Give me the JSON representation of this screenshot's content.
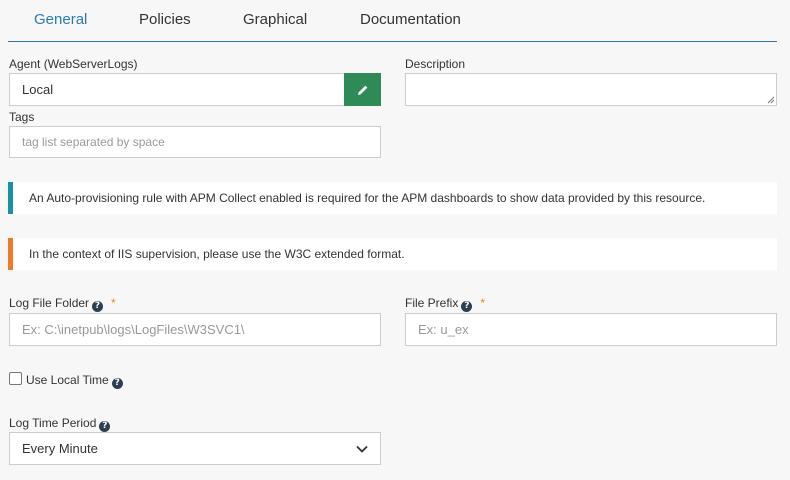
{
  "tabs": [
    {
      "label": "General",
      "active": true
    },
    {
      "label": "Policies",
      "active": false
    },
    {
      "label": "Graphical",
      "active": false
    },
    {
      "label": "Documentation",
      "active": false
    }
  ],
  "agent": {
    "label": "Agent (WebServerLogs)",
    "value": "Local",
    "edit_icon": "pencil-icon"
  },
  "description": {
    "label": "Description",
    "value": ""
  },
  "tags": {
    "label": "Tags",
    "placeholder": "tag list separated by space"
  },
  "alerts": {
    "info": "An Auto-provisioning rule with APM Collect enabled is required for the APM dashboards to show data provided by this resource.",
    "warning": "In the context of IIS supervision, please use the W3C extended format."
  },
  "log_file_folder": {
    "label": "Log File Folder",
    "required_mark": "*",
    "placeholder": "Ex: C:\\inetpub\\logs\\LogFiles\\W3SVC1\\"
  },
  "file_prefix": {
    "label": "File Prefix",
    "required_mark": "*",
    "placeholder": "Ex: u_ex"
  },
  "use_local_time": {
    "label": "Use Local Time",
    "checked": false
  },
  "log_time_period": {
    "label": "Log Time Period",
    "selected": "Every Minute"
  },
  "help_glyph": "?",
  "colors": {
    "accent": "#2a7ab0",
    "edit_button": "#2e8b57",
    "info": "#1a8fa8",
    "warning": "#f07a2a"
  }
}
